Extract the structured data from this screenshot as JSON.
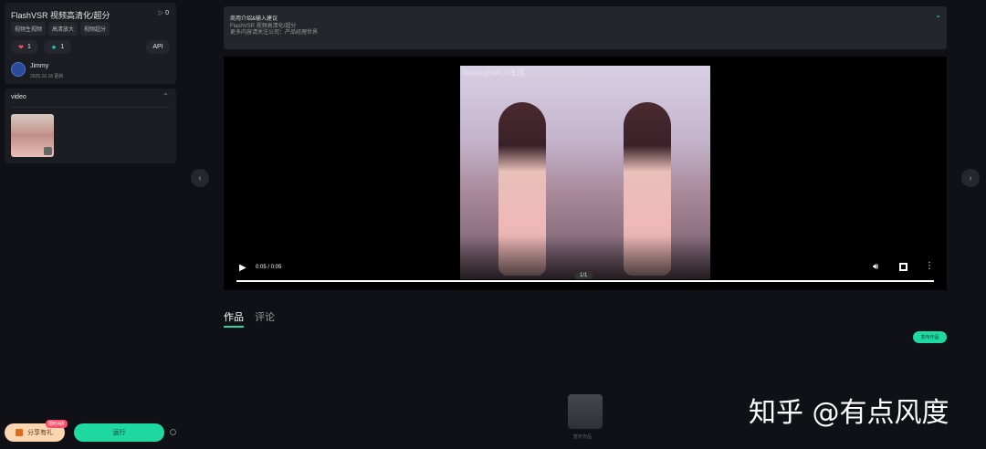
{
  "app": {
    "title": "FlashVSR 视频高清化/超分",
    "play_count": "0",
    "tags": [
      "视频生视频",
      "高清放大",
      "视频超分"
    ],
    "likes": "1",
    "favorites": "1",
    "api_label": "API",
    "author": "Jimmy",
    "updated": "2025.10.18 更新"
  },
  "input": {
    "section_label": "video",
    "collapse_icon": "chevron-up-icon"
  },
  "notice": {
    "lines": [
      "商用介绍&输入建议",
      "FlashVSR 视频高清化/超分",
      "更多内容请关注公司：产品经理世界"
    ]
  },
  "video": {
    "watermark": "RunningHub AI生成",
    "time": "0:05 / 0:05",
    "page": "1/1",
    "progress": 1.0
  },
  "tabs": [
    {
      "label": "作品",
      "active": true
    },
    {
      "label": "评论",
      "active": false
    }
  ],
  "publish_label": "发布作品",
  "empty_label": "暂无作品",
  "bottom": {
    "share_label": "分享有礼",
    "share_badge": "限时4折",
    "run_label": "运行"
  },
  "overlay_watermark": "知乎 @有点风度",
  "colors": {
    "accent": "#1ed9a0",
    "bg": "#101116",
    "card": "#1b1d22"
  }
}
